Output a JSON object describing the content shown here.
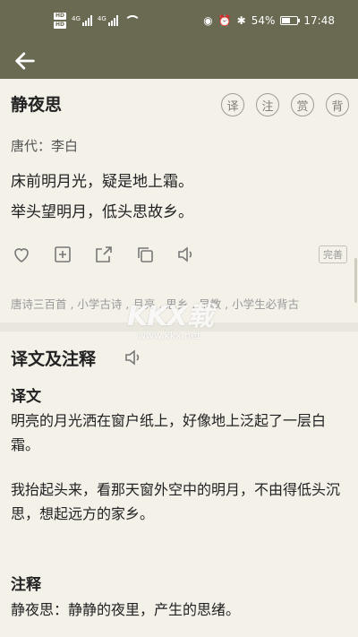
{
  "status": {
    "battery": "54%",
    "time": "17:48",
    "battery_level": 0.54
  },
  "poem": {
    "title": "静夜思",
    "author_line": "唐代：李白",
    "lines": [
      "床前明月光，疑是地上霜。",
      "举头望明月，低头思故乡。"
    ],
    "tools": [
      "译",
      "注",
      "赏",
      "背"
    ],
    "perfect_label": "完善",
    "tags": "唐诗三百首 , 小学古诗 , 月亮 , 思乡 , 早教 , 小学生必背古"
  },
  "icons": {
    "back": "arrow-left-icon",
    "actions": [
      "heart-icon",
      "add-box-icon",
      "share-icon",
      "copy-icon",
      "speaker-icon"
    ]
  },
  "watermark": {
    "logo": "KKX载",
    "url": "www.kkx.net"
  },
  "section": {
    "title": "译文及注释",
    "translation_heading": "译文",
    "translation_p1": "明亮的月光洒在窗户纸上，好像地上泛起了一层白霜。",
    "translation_p2": "我抬起头来，看那天窗外空中的明月，不由得低头沉思，想起远方的家乡。",
    "notes_heading": "注释",
    "notes_p1": "静夜思：静静的夜里，产生的思绪。"
  },
  "colors": {
    "accent": "#6a6951",
    "background": "#f4f1e9"
  }
}
